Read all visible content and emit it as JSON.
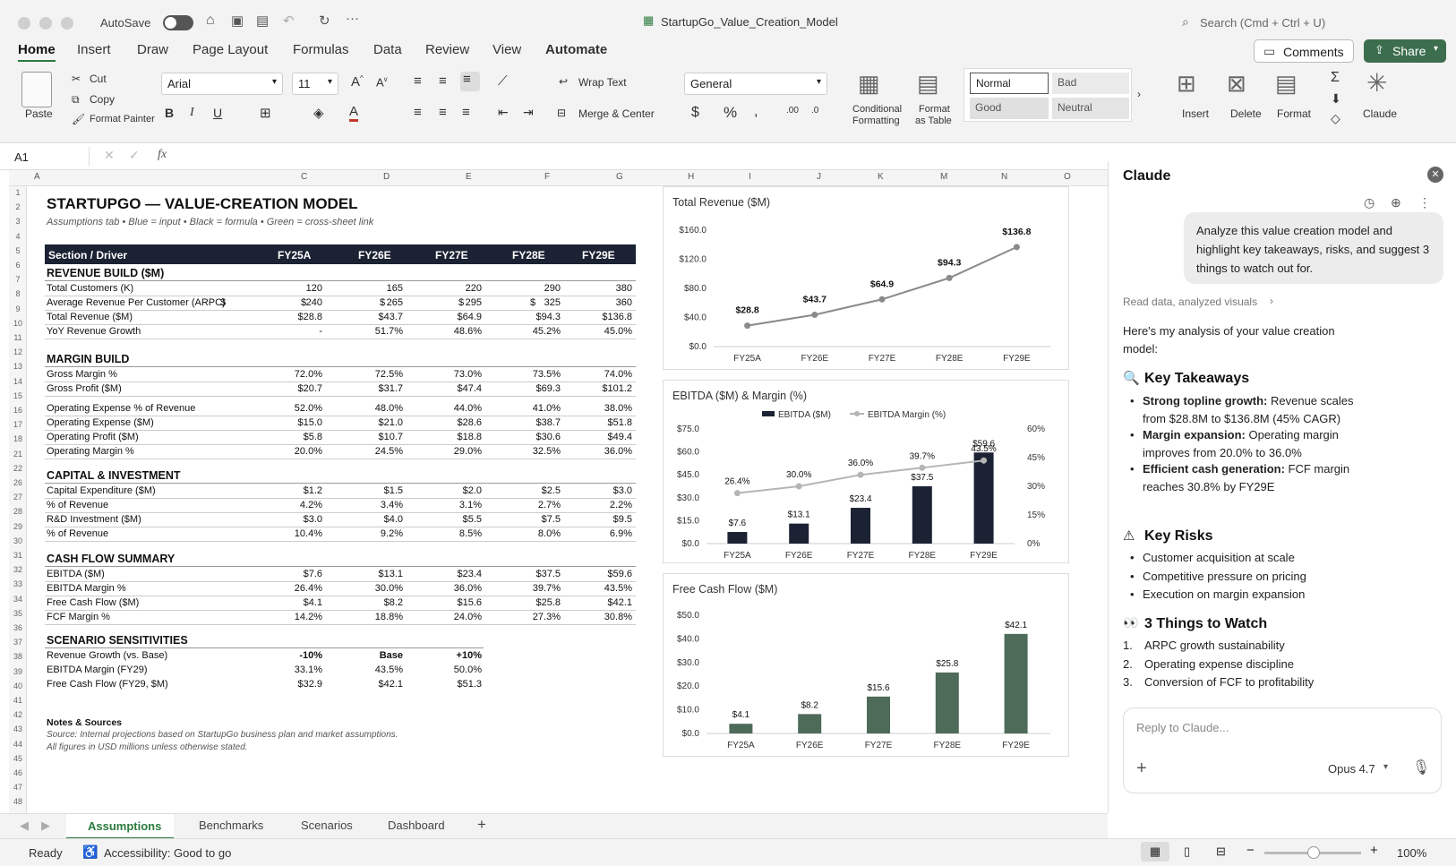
{
  "window": {
    "title": "StartupGo_Value_Creation_Model",
    "autosave": "AutoSave",
    "search_placeholder": "Search (Cmd + Ctrl + U)",
    "comments": "Comments",
    "share": "Share"
  },
  "menu": [
    "Home",
    "Insert",
    "Draw",
    "Page Layout",
    "Formulas",
    "Data",
    "Review",
    "View",
    "Automate"
  ],
  "ribbon": {
    "paste": "Paste",
    "cut": "Cut",
    "copy": "Copy",
    "format_painter": "Format Painter",
    "font": "Arial",
    "size": "11",
    "wrap": "Wrap Text",
    "merge": "Merge & Center",
    "number_format": "General",
    "cond_fmt_1": "Conditional",
    "cond_fmt_2": "Formatting",
    "fmt_table_1": "Format",
    "fmt_table_2": "as Table",
    "styles": {
      "normal": "Normal",
      "bad": "Bad",
      "good": "Good",
      "neutral": "Neutral"
    },
    "insert": "Insert",
    "delete": "Delete",
    "format": "Format",
    "claude": "Claude"
  },
  "formula_bar": {
    "cell": "A1",
    "fx": "fx"
  },
  "columns": [
    "A",
    "C",
    "D",
    "E",
    "F",
    "G",
    "H",
    "I",
    "J",
    "K",
    "M",
    "N",
    "O"
  ],
  "sheet": {
    "title": "STARTUPGO — VALUE-CREATION MODEL",
    "subtitle": "Assumptions tab • Blue = input • Black = formula • Green = cross-sheet link",
    "header": [
      "Section / Driver",
      "FY25A",
      "FY26E",
      "FY27E",
      "FY28E",
      "FY29E"
    ],
    "sections": [
      {
        "title": "REVENUE BUILD ($M)",
        "rows": [
          {
            "label": "Total Customers (K)",
            "v": [
              "120",
              "165",
              "220",
              "290",
              "380"
            ]
          },
          {
            "label": "Average Revenue Per Customer (ARPC)",
            "v": [
              "240",
              "265",
              "295",
              "325",
              "360"
            ],
            "dollar": "$"
          },
          {
            "label": "Total Revenue ($M)",
            "v": [
              "$28.8",
              "$43.7",
              "$64.9",
              "$94.3",
              "$136.8"
            ]
          },
          {
            "label": "YoY Revenue Growth",
            "v": [
              "-",
              "51.7%",
              "48.6%",
              "45.2%",
              "45.0%"
            ]
          }
        ]
      },
      {
        "title": "MARGIN BUILD",
        "rows": [
          {
            "label": "Gross Margin %",
            "v": [
              "72.0%",
              "72.5%",
              "73.0%",
              "73.5%",
              "74.0%"
            ]
          },
          {
            "label": "Gross Profit ($M)",
            "v": [
              "$20.7",
              "$31.7",
              "$47.4",
              "$69.3",
              "$101.2"
            ]
          },
          {
            "label": "Operating Expense % of Revenue",
            "v": [
              "52.0%",
              "48.0%",
              "44.0%",
              "41.0%",
              "38.0%"
            ]
          },
          {
            "label": "Operating Expense ($M)",
            "v": [
              "$15.0",
              "$21.0",
              "$28.6",
              "$38.7",
              "$51.8"
            ]
          },
          {
            "label": "Operating Profit ($M)",
            "v": [
              "$5.8",
              "$10.7",
              "$18.8",
              "$30.6",
              "$49.4"
            ]
          },
          {
            "label": "Operating Margin %",
            "v": [
              "20.0%",
              "24.5%",
              "29.0%",
              "32.5%",
              "36.0%"
            ]
          }
        ]
      },
      {
        "title": "CAPITAL & INVESTMENT",
        "rows": [
          {
            "label": "Capital Expenditure ($M)",
            "v": [
              "$1.2",
              "$1.5",
              "$2.0",
              "$2.5",
              "$3.0"
            ]
          },
          {
            "label": "% of Revenue",
            "v": [
              "4.2%",
              "3.4%",
              "3.1%",
              "2.7%",
              "2.2%"
            ]
          },
          {
            "label": "R&D Investment ($M)",
            "v": [
              "$3.0",
              "$4.0",
              "$5.5",
              "$7.5",
              "$9.5"
            ]
          },
          {
            "label": "% of Revenue",
            "v": [
              "10.4%",
              "9.2%",
              "8.5%",
              "8.0%",
              "6.9%"
            ]
          }
        ]
      },
      {
        "title": "CASH FLOW SUMMARY",
        "rows": [
          {
            "label": "EBITDA ($M)",
            "v": [
              "$7.6",
              "$13.1",
              "$23.4",
              "$37.5",
              "$59.6"
            ]
          },
          {
            "label": "EBITDA Margin %",
            "v": [
              "26.4%",
              "30.0%",
              "36.0%",
              "39.7%",
              "43.5%"
            ]
          },
          {
            "label": "Free Cash Flow ($M)",
            "v": [
              "$4.1",
              "$8.2",
              "$15.6",
              "$25.8",
              "$42.1"
            ]
          },
          {
            "label": "FCF Margin %",
            "v": [
              "14.2%",
              "18.8%",
              "24.0%",
              "27.3%",
              "30.8%"
            ]
          }
        ]
      }
    ],
    "scenario": {
      "title": "SCENARIO SENSITIVITIES",
      "header": [
        "-10%",
        "Base",
        "+10%"
      ],
      "rows": [
        {
          "label": "Revenue Growth (vs. Base)",
          "v": [
            "",
            "",
            ""
          ]
        },
        {
          "label": "EBITDA Margin (FY29)",
          "v": [
            "33.1%",
            "43.5%",
            "50.0%"
          ]
        },
        {
          "label": "Free Cash Flow (FY29, $M)",
          "v": [
            "$32.9",
            "$42.1",
            "$51.3"
          ]
        }
      ]
    },
    "notes_title": "Notes & Sources",
    "notes": [
      "Source: Internal projections based on StartupGo business plan and market assumptions.",
      "All figures in USD millions unless otherwise stated."
    ]
  },
  "chart_data": [
    {
      "type": "line",
      "title": "Total Revenue ($M)",
      "categories": [
        "FY25A",
        "FY26E",
        "FY27E",
        "FY28E",
        "FY29E"
      ],
      "values": [
        28.8,
        43.7,
        64.9,
        94.3,
        136.8
      ],
      "labels": [
        "$28.8",
        "$43.7",
        "$64.9",
        "$94.3",
        "$136.8"
      ],
      "ylim": [
        0,
        160
      ],
      "yticks": [
        "$0.0",
        "$40.0",
        "$80.0",
        "$120.0",
        "$160.0"
      ],
      "color": "#8a8a8a"
    },
    {
      "type": "bar",
      "title": "EBITDA ($M) & Margin (%)",
      "categories": [
        "FY25A",
        "FY26E",
        "FY27E",
        "FY28E",
        "FY29E"
      ],
      "series": [
        {
          "name": "EBITDA ($M)",
          "values": [
            7.6,
            13.1,
            23.4,
            37.5,
            59.6
          ],
          "labels": [
            "$7.6",
            "$13.1",
            "$23.4",
            "$37.5",
            "$59.6"
          ],
          "color": "#1b2233"
        },
        {
          "name": "EBITDA Margin (%)",
          "values": [
            26.4,
            30.0,
            36.0,
            39.7,
            43.5
          ],
          "labels": [
            "26.4%",
            "30.0%",
            "36.0%",
            "39.7%",
            "43.5%"
          ],
          "color": "#b5b5b5"
        }
      ],
      "ylim": [
        0,
        75
      ],
      "yticks": [
        "$0.0",
        "$15.0",
        "$30.0",
        "$45.0",
        "$60.0",
        "$75.0"
      ],
      "y2lim": [
        0,
        60
      ],
      "y2ticks": [
        "0%",
        "15%",
        "30%",
        "45%",
        "60%"
      ],
      "legend": "top-center"
    },
    {
      "type": "bar",
      "title": "Free Cash Flow ($M)",
      "categories": [
        "FY25A",
        "FY26E",
        "FY27E",
        "FY28E",
        "FY29E"
      ],
      "values": [
        4.1,
        8.2,
        15.6,
        25.8,
        42.1
      ],
      "labels": [
        "$4.1",
        "$8.2",
        "$15.6",
        "$25.8",
        "$42.1"
      ],
      "ylim": [
        0,
        50
      ],
      "yticks": [
        "$0.0",
        "$10.0",
        "$20.0",
        "$30.0",
        "$40.0",
        "$50.0"
      ],
      "color": "#4e6b5a"
    }
  ],
  "claude": {
    "title": "Claude",
    "user_msg": "Analyze this value creation model and highlight key takeaways, risks, and suggest 3 things to watch out for.",
    "read_data": "Read data, analyzed visuals",
    "intro": "Here's my analysis of your value creation model:",
    "takeaways_title": "Key Takeaways",
    "takeaways": [
      {
        "b": "Strong topline growth:",
        "t": " Revenue scales from $28.8M to $136.8M (45% CAGR)"
      },
      {
        "b": "Margin expansion:",
        "t": " Operating margin improves from 20.0% to 36.0%"
      },
      {
        "b": "Efficient cash generation:",
        "t": " FCF margin reaches 30.8% by FY29E"
      }
    ],
    "risks_title": "Key Risks",
    "risks": [
      "Customer acquisition at scale",
      "Competitive pressure on pricing",
      "Execution on margin expansion"
    ],
    "watch_title": "3 Things to Watch",
    "watch": [
      "ARPC growth sustainability",
      "Operating expense discipline",
      "Conversion of FCF to profitability"
    ],
    "reply_placeholder": "Reply to Claude...",
    "model": "Opus 4.7"
  },
  "tabs": [
    "Assumptions",
    "Benchmarks",
    "Scenarios",
    "Dashboard"
  ],
  "status": {
    "ready": "Ready",
    "accessibility": "Accessibility: Good to go",
    "zoom": "100%"
  }
}
